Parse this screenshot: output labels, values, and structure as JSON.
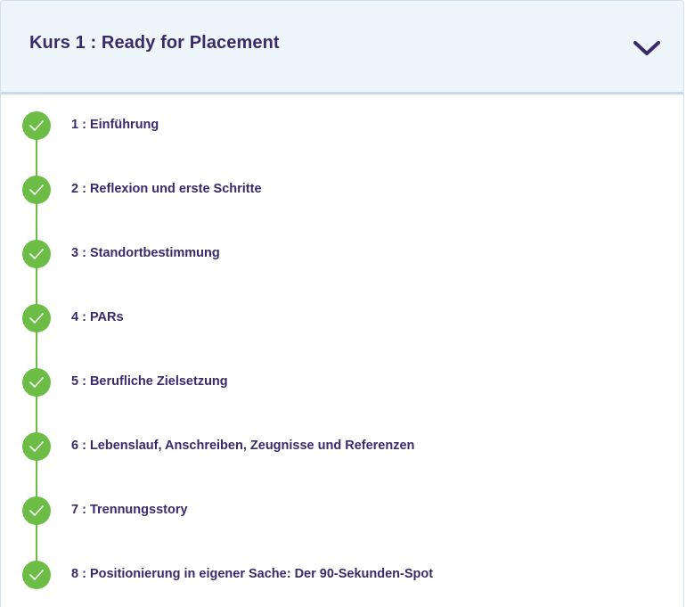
{
  "course": {
    "title": "Kurs 1 : Ready for Placement",
    "expand_icon": "chevron-down-icon",
    "colors": {
      "title": "#3a2a6c",
      "header_bg": "#eef6fb",
      "complete": "#6cbd45"
    },
    "lessons": [
      {
        "label": "1 : Einführung",
        "status": "completed"
      },
      {
        "label": "2 : Reflexion und erste Schritte",
        "status": "completed"
      },
      {
        "label": "3 : Standortbestimmung",
        "status": "completed"
      },
      {
        "label": "4 : PARs",
        "status": "completed"
      },
      {
        "label": "5 : Berufliche Zielsetzung",
        "status": "completed"
      },
      {
        "label": "6 : Lebenslauf, Anschreiben, Zeugnisse und Referenzen",
        "status": "completed"
      },
      {
        "label": "7 : Trennungsstory",
        "status": "completed"
      },
      {
        "label": "8 : Positionierung in eigener Sache: Der 90-Sekunden-Spot",
        "status": "completed"
      }
    ]
  }
}
